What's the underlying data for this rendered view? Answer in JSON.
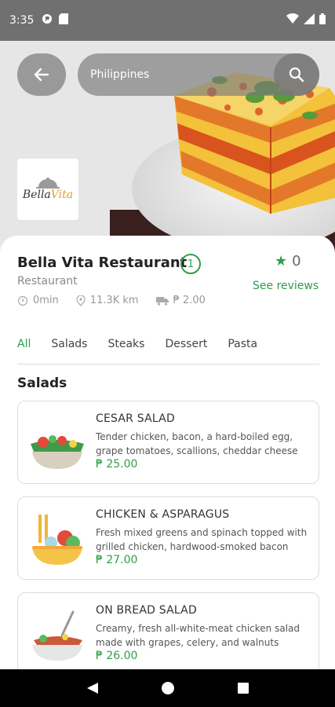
{
  "status_bar": {
    "time": "3:35"
  },
  "hero": {
    "search_text": "Philippines",
    "logo_main": "Bella",
    "logo_accent": "Vita"
  },
  "restaurant": {
    "name": "Bella Vita Restaurant",
    "badge": "1",
    "type": "Restaurant",
    "time": "0min",
    "distance": "11.3K km",
    "delivery_fee": "₱ 2.00",
    "rating": "0",
    "see_reviews": "See reviews"
  },
  "tabs": [
    "All",
    "Salads",
    "Steaks",
    "Dessert",
    "Pasta"
  ],
  "section_title": "Salads",
  "items": [
    {
      "title": "CESAR SALAD",
      "desc": "Tender chicken, bacon, a hard-boiled egg, grape tomatoes, scallions, cheddar cheese",
      "price": "₱ 25.00"
    },
    {
      "title": "CHICKEN & ASPARAGUS",
      "desc": "Fresh mixed greens and spinach topped with grilled chicken, hardwood-smoked bacon",
      "price": "₱ 27.00"
    },
    {
      "title": "ON BREAD SALAD",
      "desc": "Creamy, fresh all-white-meat chicken salad made with grapes, celery, and walnuts",
      "price": "₱ 26.00"
    }
  ],
  "colors": {
    "accent": "#2e9e4a",
    "statusbar": "#707070"
  }
}
